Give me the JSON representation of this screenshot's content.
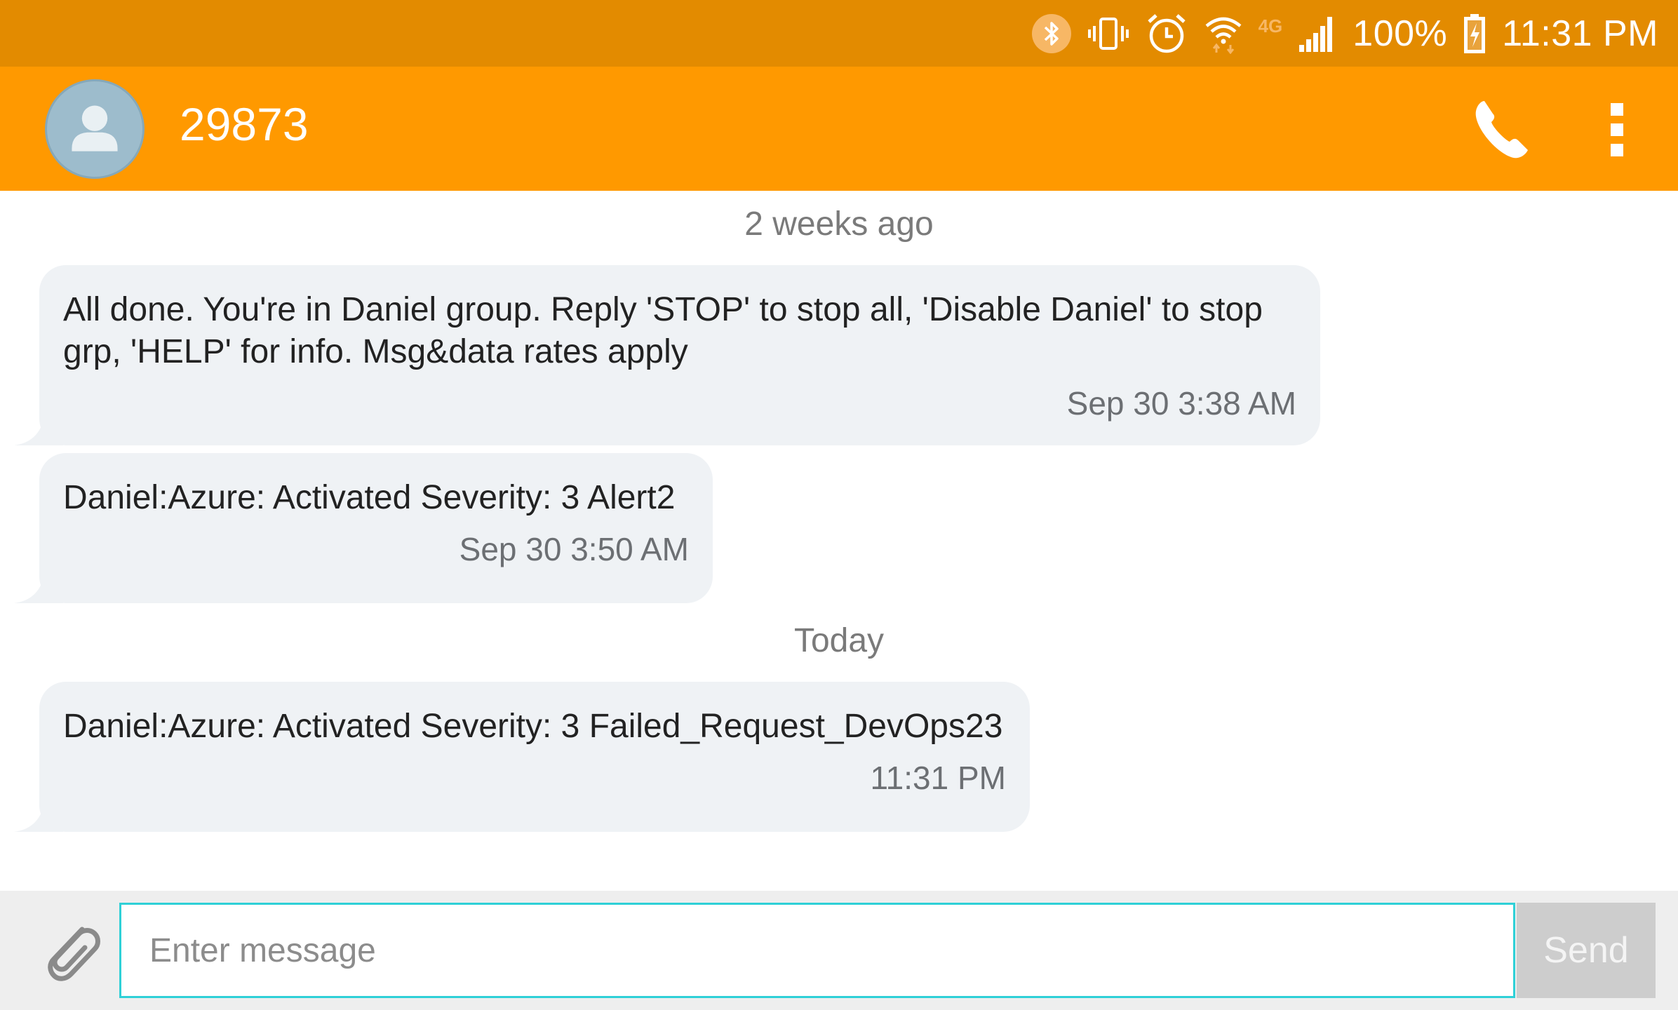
{
  "status_bar": {
    "battery_percent": "100%",
    "time": "11:31 PM",
    "network_label": "4G",
    "icons": [
      "bluetooth-icon",
      "vibrate-icon",
      "alarm-icon",
      "wifi-icon",
      "signal-icon",
      "battery-charging-icon"
    ]
  },
  "app_bar": {
    "contact": "29873",
    "icons": [
      "avatar-icon",
      "phone-icon",
      "more-vert-icon"
    ]
  },
  "conversation": {
    "groups": [
      {
        "label": "2 weeks ago",
        "messages": [
          {
            "text": "All done. You're in Daniel group. Reply 'STOP' to stop all, 'Disable Daniel' to stop\ngrp, 'HELP' for info. Msg&data rates apply",
            "time": "Sep 30 3:38 AM"
          },
          {
            "text": "Daniel:Azure: Activated Severity: 3 Alert2",
            "time": "Sep 30 3:50 AM"
          }
        ]
      },
      {
        "label": "Today",
        "messages": [
          {
            "text": "Daniel:Azure: Activated Severity: 3 Failed_Request_DevOps23",
            "time": "11:31 PM"
          }
        ]
      }
    ]
  },
  "compose": {
    "placeholder": "Enter message",
    "value": "",
    "send_label": "Send",
    "attach_icon": "paperclip-icon"
  },
  "colors": {
    "status_bar": "#e38b00",
    "app_bar": "#ff9900",
    "bubble": "#eff2f5",
    "input_border": "#2fd0d7",
    "send_button": "#cdcdcd"
  }
}
